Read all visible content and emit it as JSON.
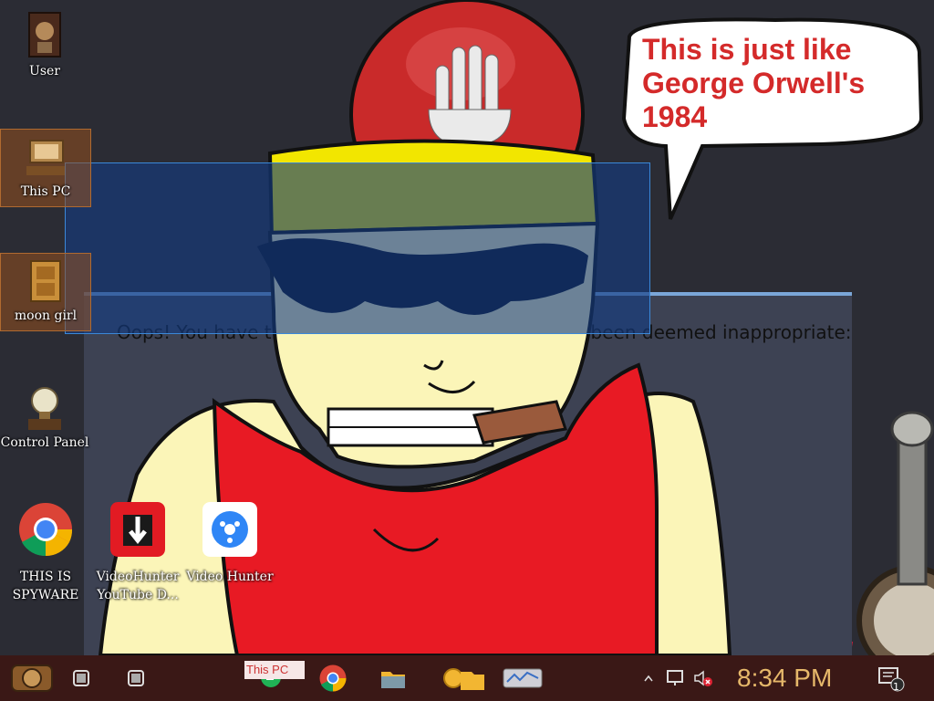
{
  "desktop": {
    "icons": [
      {
        "label": "User",
        "icon": "steampunk-user-icon"
      },
      {
        "label": "This PC",
        "icon": "steampunk-computer-icon"
      },
      {
        "label": "moon girl",
        "icon": "wooden-cabinet-icon"
      },
      {
        "label": "Control Panel",
        "icon": "lightbulb-icon"
      }
    ],
    "apps": [
      {
        "label": "THIS IS SPYWARE",
        "icon": "chrome-icon"
      },
      {
        "label": "VideoHunter YouTube D...",
        "icon": "videohunter-youtube-icon"
      },
      {
        "label": "Video Hunter",
        "icon": "video-hunter-icon"
      }
    ]
  },
  "blocked_page": {
    "message_left": "Oops! You have tr",
    "message_right": "as been deemed inappropriate:"
  },
  "speech_bubble": {
    "lines": [
      "This is just like",
      "George Orwell's",
      "1984"
    ]
  },
  "taskbar": {
    "tooltip": "This PC",
    "clock": "8:34 PM",
    "notification_count": "1",
    "colors": {
      "background": "#3a1816",
      "clock": "#e6b86a"
    }
  }
}
